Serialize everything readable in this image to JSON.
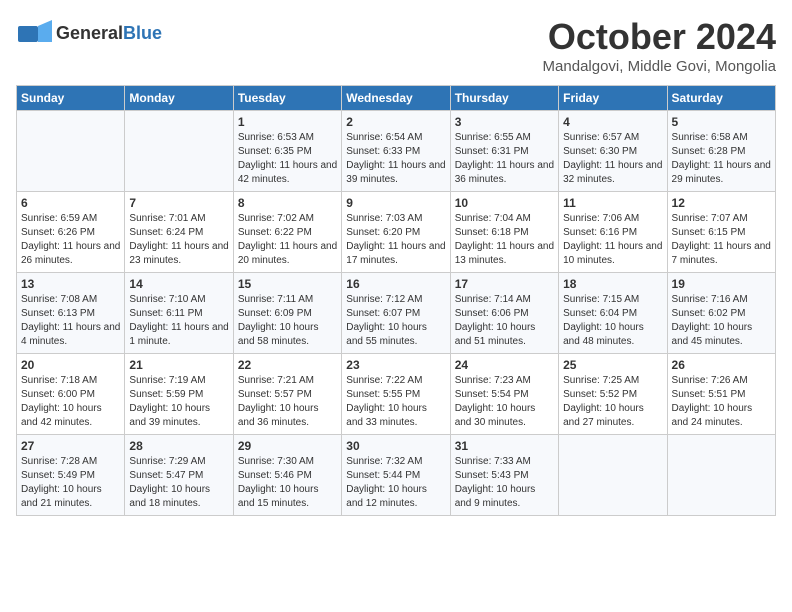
{
  "header": {
    "logo_general": "General",
    "logo_blue": "Blue",
    "month_title": "October 2024",
    "location": "Mandalgovi, Middle Govi, Mongolia"
  },
  "days_of_week": [
    "Sunday",
    "Monday",
    "Tuesday",
    "Wednesday",
    "Thursday",
    "Friday",
    "Saturday"
  ],
  "weeks": [
    [
      {
        "day": "",
        "sunrise": "",
        "sunset": "",
        "daylight": ""
      },
      {
        "day": "",
        "sunrise": "",
        "sunset": "",
        "daylight": ""
      },
      {
        "day": "1",
        "sunrise": "Sunrise: 6:53 AM",
        "sunset": "Sunset: 6:35 PM",
        "daylight": "Daylight: 11 hours and 42 minutes."
      },
      {
        "day": "2",
        "sunrise": "Sunrise: 6:54 AM",
        "sunset": "Sunset: 6:33 PM",
        "daylight": "Daylight: 11 hours and 39 minutes."
      },
      {
        "day": "3",
        "sunrise": "Sunrise: 6:55 AM",
        "sunset": "Sunset: 6:31 PM",
        "daylight": "Daylight: 11 hours and 36 minutes."
      },
      {
        "day": "4",
        "sunrise": "Sunrise: 6:57 AM",
        "sunset": "Sunset: 6:30 PM",
        "daylight": "Daylight: 11 hours and 32 minutes."
      },
      {
        "day": "5",
        "sunrise": "Sunrise: 6:58 AM",
        "sunset": "Sunset: 6:28 PM",
        "daylight": "Daylight: 11 hours and 29 minutes."
      }
    ],
    [
      {
        "day": "6",
        "sunrise": "Sunrise: 6:59 AM",
        "sunset": "Sunset: 6:26 PM",
        "daylight": "Daylight: 11 hours and 26 minutes."
      },
      {
        "day": "7",
        "sunrise": "Sunrise: 7:01 AM",
        "sunset": "Sunset: 6:24 PM",
        "daylight": "Daylight: 11 hours and 23 minutes."
      },
      {
        "day": "8",
        "sunrise": "Sunrise: 7:02 AM",
        "sunset": "Sunset: 6:22 PM",
        "daylight": "Daylight: 11 hours and 20 minutes."
      },
      {
        "day": "9",
        "sunrise": "Sunrise: 7:03 AM",
        "sunset": "Sunset: 6:20 PM",
        "daylight": "Daylight: 11 hours and 17 minutes."
      },
      {
        "day": "10",
        "sunrise": "Sunrise: 7:04 AM",
        "sunset": "Sunset: 6:18 PM",
        "daylight": "Daylight: 11 hours and 13 minutes."
      },
      {
        "day": "11",
        "sunrise": "Sunrise: 7:06 AM",
        "sunset": "Sunset: 6:16 PM",
        "daylight": "Daylight: 11 hours and 10 minutes."
      },
      {
        "day": "12",
        "sunrise": "Sunrise: 7:07 AM",
        "sunset": "Sunset: 6:15 PM",
        "daylight": "Daylight: 11 hours and 7 minutes."
      }
    ],
    [
      {
        "day": "13",
        "sunrise": "Sunrise: 7:08 AM",
        "sunset": "Sunset: 6:13 PM",
        "daylight": "Daylight: 11 hours and 4 minutes."
      },
      {
        "day": "14",
        "sunrise": "Sunrise: 7:10 AM",
        "sunset": "Sunset: 6:11 PM",
        "daylight": "Daylight: 11 hours and 1 minute."
      },
      {
        "day": "15",
        "sunrise": "Sunrise: 7:11 AM",
        "sunset": "Sunset: 6:09 PM",
        "daylight": "Daylight: 10 hours and 58 minutes."
      },
      {
        "day": "16",
        "sunrise": "Sunrise: 7:12 AM",
        "sunset": "Sunset: 6:07 PM",
        "daylight": "Daylight: 10 hours and 55 minutes."
      },
      {
        "day": "17",
        "sunrise": "Sunrise: 7:14 AM",
        "sunset": "Sunset: 6:06 PM",
        "daylight": "Daylight: 10 hours and 51 minutes."
      },
      {
        "day": "18",
        "sunrise": "Sunrise: 7:15 AM",
        "sunset": "Sunset: 6:04 PM",
        "daylight": "Daylight: 10 hours and 48 minutes."
      },
      {
        "day": "19",
        "sunrise": "Sunrise: 7:16 AM",
        "sunset": "Sunset: 6:02 PM",
        "daylight": "Daylight: 10 hours and 45 minutes."
      }
    ],
    [
      {
        "day": "20",
        "sunrise": "Sunrise: 7:18 AM",
        "sunset": "Sunset: 6:00 PM",
        "daylight": "Daylight: 10 hours and 42 minutes."
      },
      {
        "day": "21",
        "sunrise": "Sunrise: 7:19 AM",
        "sunset": "Sunset: 5:59 PM",
        "daylight": "Daylight: 10 hours and 39 minutes."
      },
      {
        "day": "22",
        "sunrise": "Sunrise: 7:21 AM",
        "sunset": "Sunset: 5:57 PM",
        "daylight": "Daylight: 10 hours and 36 minutes."
      },
      {
        "day": "23",
        "sunrise": "Sunrise: 7:22 AM",
        "sunset": "Sunset: 5:55 PM",
        "daylight": "Daylight: 10 hours and 33 minutes."
      },
      {
        "day": "24",
        "sunrise": "Sunrise: 7:23 AM",
        "sunset": "Sunset: 5:54 PM",
        "daylight": "Daylight: 10 hours and 30 minutes."
      },
      {
        "day": "25",
        "sunrise": "Sunrise: 7:25 AM",
        "sunset": "Sunset: 5:52 PM",
        "daylight": "Daylight: 10 hours and 27 minutes."
      },
      {
        "day": "26",
        "sunrise": "Sunrise: 7:26 AM",
        "sunset": "Sunset: 5:51 PM",
        "daylight": "Daylight: 10 hours and 24 minutes."
      }
    ],
    [
      {
        "day": "27",
        "sunrise": "Sunrise: 7:28 AM",
        "sunset": "Sunset: 5:49 PM",
        "daylight": "Daylight: 10 hours and 21 minutes."
      },
      {
        "day": "28",
        "sunrise": "Sunrise: 7:29 AM",
        "sunset": "Sunset: 5:47 PM",
        "daylight": "Daylight: 10 hours and 18 minutes."
      },
      {
        "day": "29",
        "sunrise": "Sunrise: 7:30 AM",
        "sunset": "Sunset: 5:46 PM",
        "daylight": "Daylight: 10 hours and 15 minutes."
      },
      {
        "day": "30",
        "sunrise": "Sunrise: 7:32 AM",
        "sunset": "Sunset: 5:44 PM",
        "daylight": "Daylight: 10 hours and 12 minutes."
      },
      {
        "day": "31",
        "sunrise": "Sunrise: 7:33 AM",
        "sunset": "Sunset: 5:43 PM",
        "daylight": "Daylight: 10 hours and 9 minutes."
      },
      {
        "day": "",
        "sunrise": "",
        "sunset": "",
        "daylight": ""
      },
      {
        "day": "",
        "sunrise": "",
        "sunset": "",
        "daylight": ""
      }
    ]
  ]
}
